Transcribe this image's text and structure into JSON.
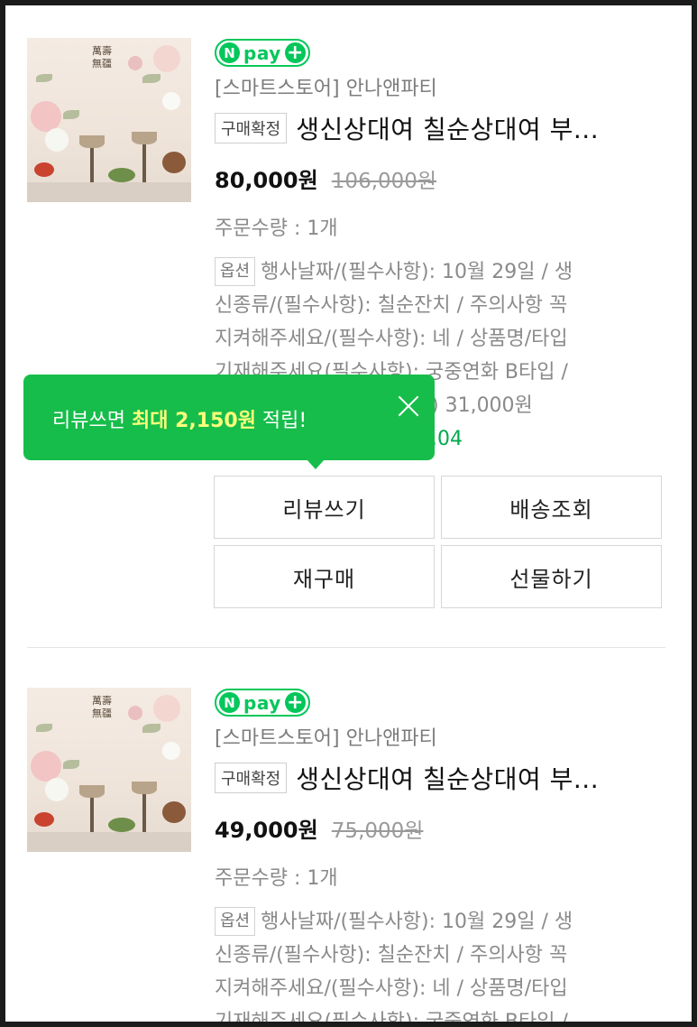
{
  "orders": [
    {
      "payment_badge": {
        "n": "N",
        "pay": "pay",
        "plus": "+"
      },
      "store": "[스마트스토어] 안나앤파티",
      "status": "구매확정",
      "title": "생신상대여 칠순상대여 부...",
      "price": "80,000원",
      "original_price": "106,000원",
      "quantity": "주문수량 : 1개",
      "option_label": "옵션",
      "option_lines": [
        "행사날짜/(필수사항): 10월 29일 / 생",
        "신종류/(필수사항): 칠순잔치 / 주의사항 꼭",
        "지켜해주세요/(필수사항): 네 / 상품명/타입",
        "기재해주세요(필수사항): 궁중연화 B타입 /"
      ],
      "option_price_visible": ") 31,000원",
      "date_visible": ".04",
      "buttons": {
        "review": "리뷰쓰기",
        "tracking": "배송조회",
        "rebuy": "재구매",
        "gift": "선물하기"
      }
    },
    {
      "payment_badge": {
        "n": "N",
        "pay": "pay",
        "plus": "+"
      },
      "store": "[스마트스토어] 안나앤파티",
      "status": "구매확정",
      "title": "생신상대여 칠순상대여 부...",
      "price": "49,000원",
      "original_price": "75,000원",
      "quantity": "주문수량 : 1개",
      "option_label": "옵션",
      "option_lines": [
        "행사날짜/(필수사항): 10월 29일 / 생",
        "신종류/(필수사항): 칠순잔치 / 주의사항 꼭",
        "지켜해주세요/(필수사항): 네 / 상품명/타입",
        "기재해주세요(필수사항): 궁중연화 B타입 /"
      ]
    }
  ],
  "tooltip": {
    "prefix": "리뷰쓰면 ",
    "highlight": "최대 2,150원",
    "suffix": " 적립!"
  },
  "thumbnail": {
    "calligraphy": "萬壽無疆"
  },
  "colors": {
    "brand_green": "#03c75a",
    "tooltip_green": "#16bd4a",
    "highlight_yellow": "#fbff7b"
  }
}
